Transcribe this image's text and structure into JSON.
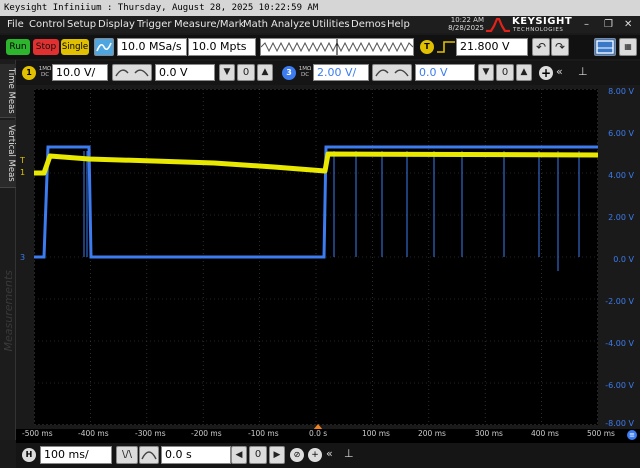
{
  "window": {
    "title": "Keysight Infiniium : Thursday, August 28, 2025 10:22:59 AM"
  },
  "menu": [
    "File",
    "Control",
    "Setup",
    "Display",
    "Trigger",
    "Measure/Mark",
    "Math",
    "Analyze",
    "Utilities",
    "Demos",
    "Help"
  ],
  "clock": {
    "time": "10:22 AM",
    "date": "8/28/2025"
  },
  "brand": {
    "name": "KEYSIGHT",
    "sub": "TECHNOLOGIES"
  },
  "toolbar": {
    "run_label": "Run",
    "stop_label": "Stop",
    "single_label": "Single",
    "sample_rate": "10.0 MSa/s",
    "memory_depth": "10.0 Mpts",
    "trigger_badge": "T",
    "trigger_level": "21.800 V"
  },
  "channels": [
    {
      "number": "1",
      "coupling_top": "1MΩ",
      "coupling_bottom": "DC",
      "scale": "10.0 V/",
      "offset": "0.0 V",
      "color": "#e8e800"
    },
    {
      "number": "3",
      "coupling_top": "1MΩ",
      "coupling_bottom": "DC",
      "scale": "2.00 V/",
      "offset": "0.0 V",
      "color": "#3c7cf0"
    }
  ],
  "side_tabs": {
    "time_meas": "Time Meas",
    "vertical_meas": "Vertical Meas",
    "measurements": "Measurements"
  },
  "markers": {
    "trigger": "T",
    "ch1": "1",
    "ch3": "3"
  },
  "y_axis": {
    "ticks": [
      "8.00 V",
      "6.00 V",
      "4.00 V",
      "2.00 V",
      "0.0 V",
      "-2.00 V",
      "-4.00 V",
      "-6.00 V",
      "-8.00 V"
    ]
  },
  "x_axis": {
    "ticks": [
      "-500 ms",
      "-400 ms",
      "-300 ms",
      "-200 ms",
      "-100 ms",
      "0.0 s",
      "100 ms",
      "200 ms",
      "300 ms",
      "400 ms",
      "500 ms"
    ]
  },
  "timebase": {
    "badge": "H",
    "scale": "100 ms/",
    "position": "0.0 s"
  }
}
